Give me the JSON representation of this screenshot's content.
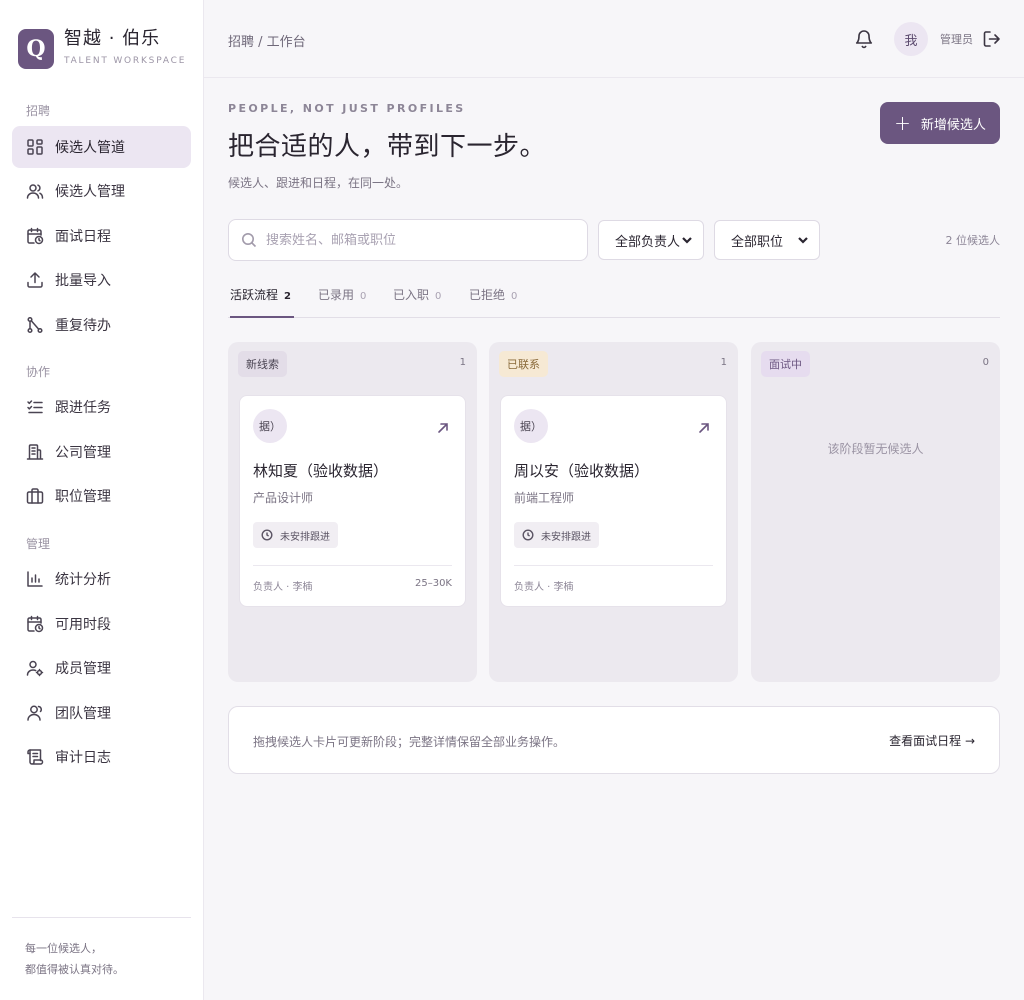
{
  "brand": {
    "logo_letter": "Q",
    "name": "智越 · 伯乐",
    "subtitle": "TALENT WORKSPACE",
    "color": "#6b5680"
  },
  "sidebar": {
    "sections": [
      {
        "title": "招聘",
        "items": [
          {
            "label": "候选人管道",
            "icon": "kanban-grid-icon",
            "active": true
          },
          {
            "label": "候选人管理",
            "icon": "users-icon"
          },
          {
            "label": "面试日程",
            "icon": "calendar-clock-icon"
          },
          {
            "label": "批量导入",
            "icon": "upload-icon"
          },
          {
            "label": "重复待办",
            "icon": "merge-icon"
          }
        ]
      },
      {
        "title": "协作",
        "items": [
          {
            "label": "跟进任务",
            "icon": "checklist-icon"
          },
          {
            "label": "公司管理",
            "icon": "building-icon"
          },
          {
            "label": "职位管理",
            "icon": "briefcase-icon"
          }
        ]
      },
      {
        "title": "管理",
        "items": [
          {
            "label": "统计分析",
            "icon": "bar-chart-icon"
          },
          {
            "label": "可用时段",
            "icon": "calendar-clock-icon"
          },
          {
            "label": "成员管理",
            "icon": "user-settings-icon"
          },
          {
            "label": "团队管理",
            "icon": "team-icon"
          },
          {
            "label": "审计日志",
            "icon": "scroll-icon"
          }
        ]
      }
    ],
    "footer_line1": "每一位候选人，",
    "footer_line2": "都值得被认真对待。"
  },
  "topbar": {
    "breadcrumb": "招聘 / 工作台",
    "avatar_text": "我",
    "role": "管理员"
  },
  "header": {
    "eyebrow": "PEOPLE, NOT JUST PROFILES",
    "title": "把合适的人，带到下一步。",
    "subtitle": "候选人、跟进和日程，在同一处。",
    "add_button": "新增候选人"
  },
  "filters": {
    "search_placeholder": "搜索姓名、邮箱或职位",
    "owner_select": "全部负责人",
    "position_select": "全部职位",
    "count_text": "2 位候选人"
  },
  "tabs": [
    {
      "label": "活跃流程",
      "count": "2",
      "active": true
    },
    {
      "label": "已录用",
      "count": "0"
    },
    {
      "label": "已入职",
      "count": "0"
    },
    {
      "label": "已拒绝",
      "count": "0"
    }
  ],
  "columns": [
    {
      "stage": "新线索",
      "count": "1",
      "tag_bg": "#e3dde8",
      "tag_color": "#4a4452",
      "card": {
        "avatar": "据）",
        "name": "林知夏（验收数据）",
        "role": "产品设计师",
        "badge": "未安排跟进",
        "owner": "负责人 · 李楠",
        "salary": "25–30K"
      }
    },
    {
      "stage": "已联系",
      "count": "1",
      "tag_bg": "#f6e9d4",
      "tag_color": "#8a6a3a",
      "card": {
        "avatar": "据）",
        "name": "周以安（验收数据）",
        "role": "前端工程师",
        "badge": "未安排跟进",
        "owner": "负责人 · 李楠",
        "salary": ""
      }
    },
    {
      "stage": "面试中",
      "count": "0",
      "tag_bg": "#e6dcef",
      "tag_color": "#6b5680",
      "empty_text": "该阶段暂无候选人"
    }
  ],
  "note": {
    "text": "拖拽候选人卡片可更新阶段；完整详情保留全部业务操作。",
    "link": "查看面试日程 →"
  }
}
